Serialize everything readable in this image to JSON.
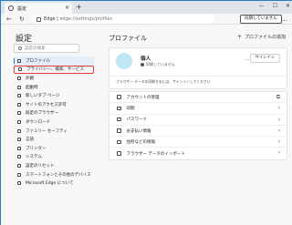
{
  "tab": {
    "title": "設定",
    "close": "×",
    "new_tab": "+"
  },
  "window_controls": {
    "minimize": "—",
    "maximize": "☐",
    "close": "✕"
  },
  "toolbar": {
    "back": "←",
    "refresh": "↻",
    "url_prefix": "Edge | ",
    "url_path": "edge://settings/profiles",
    "sync_label": "同期していません",
    "more": "…"
  },
  "sidebar": {
    "title": "設定",
    "search_placeholder": "設定の検索",
    "items": [
      {
        "label": "プロファイル",
        "icon": "person-icon",
        "active": true
      },
      {
        "label": "プライバシー、検索、サービス",
        "icon": "lock-icon",
        "highlight": true
      },
      {
        "label": "外観",
        "icon": "appearance-icon"
      },
      {
        "label": "起動時",
        "icon": "power-icon"
      },
      {
        "label": "新しいタブ ページ",
        "icon": "new-tab-icon"
      },
      {
        "label": "サイトのアクセス許可",
        "icon": "site-permissions-icon"
      },
      {
        "label": "既定のブラウザー",
        "icon": "browser-icon"
      },
      {
        "label": "ダウンロード",
        "icon": "download-icon"
      },
      {
        "label": "ファミリー セーフティ",
        "icon": "family-icon"
      },
      {
        "label": "言語",
        "icon": "language-icon"
      },
      {
        "label": "プリンター",
        "icon": "printer-icon"
      },
      {
        "label": "システム",
        "icon": "system-icon"
      },
      {
        "label": "設定のリセット",
        "icon": "reset-icon"
      },
      {
        "label": "スマートフォンとその他のデバイス",
        "icon": "phone-icon"
      },
      {
        "label": "Microsoft Edge について",
        "icon": "edge-icon"
      }
    ]
  },
  "main": {
    "title": "プロファイル",
    "add_profile": "プロファイルの追加",
    "profile": {
      "name": "個人",
      "status": "同期していません",
      "more": "…",
      "signin": "サインイン",
      "note": "ブラウザー データを同期するには、サインインしてください"
    },
    "rows": [
      {
        "label": "アカウントの管理",
        "icon": "account-icon",
        "trail": "⧉"
      },
      {
        "label": "同期",
        "icon": "sync-icon",
        "trail": "›"
      },
      {
        "label": "パスワード",
        "icon": "key-icon",
        "trail": "›"
      },
      {
        "label": "お支払い情報",
        "icon": "card-icon",
        "trail": "›"
      },
      {
        "label": "住所などの情報",
        "icon": "address-icon",
        "trail": "›"
      },
      {
        "label": "ブラウザー データのインポート",
        "icon": "import-icon",
        "trail": "›"
      }
    ]
  }
}
